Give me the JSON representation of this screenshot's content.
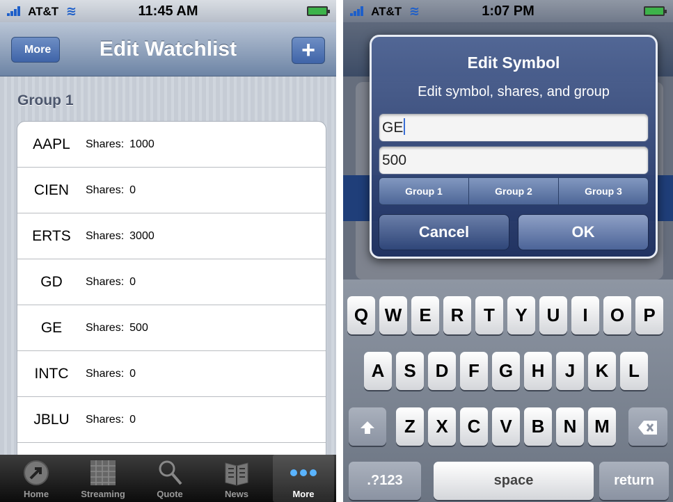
{
  "left": {
    "status": {
      "carrier": "AT&T",
      "time": "11:45 AM"
    },
    "nav": {
      "back_label": "More",
      "title": "Edit Watchlist",
      "add_label": "+"
    },
    "group_title": "Group 1",
    "shares_label": "Shares:",
    "rows": [
      {
        "symbol": "AAPL",
        "shares": "1000"
      },
      {
        "symbol": "CIEN",
        "shares": "0"
      },
      {
        "symbol": "ERTS",
        "shares": "3000"
      },
      {
        "symbol": "GD",
        "shares": "0"
      },
      {
        "symbol": "GE",
        "shares": "500"
      },
      {
        "symbol": "INTC",
        "shares": "0"
      },
      {
        "symbol": "JBLU",
        "shares": "0"
      }
    ],
    "tabs": [
      {
        "label": "Home",
        "icon": "home-icon"
      },
      {
        "label": "Streaming",
        "icon": "streaming-icon"
      },
      {
        "label": "Quote",
        "icon": "search-icon"
      },
      {
        "label": "News",
        "icon": "news-icon"
      },
      {
        "label": "More",
        "icon": "more-icon",
        "selected": true
      }
    ]
  },
  "right": {
    "status": {
      "carrier": "AT&T",
      "time": "1:07 PM"
    },
    "alert": {
      "title": "Edit Symbol",
      "message": "Edit symbol, shares, and group",
      "symbol_value": "GE",
      "shares_value": "500",
      "groups": [
        "Group 1",
        "Group 2",
        "Group 3"
      ],
      "cancel_label": "Cancel",
      "ok_label": "OK"
    },
    "keyboard": {
      "row1": [
        "Q",
        "W",
        "E",
        "R",
        "T",
        "Y",
        "U",
        "I",
        "O",
        "P"
      ],
      "row2": [
        "A",
        "S",
        "D",
        "F",
        "G",
        "H",
        "J",
        "K",
        "L"
      ],
      "row3": [
        "Z",
        "X",
        "C",
        "V",
        "B",
        "N",
        "M"
      ],
      "numbers_label": ".?123",
      "space_label": "space",
      "return_label": "return"
    }
  },
  "colors": {
    "nav_blue": "#6d84a5",
    "keyboard_bg": "#7b8595",
    "alert_blue": "#2a4479",
    "selection_blue": "#2d67d0"
  }
}
